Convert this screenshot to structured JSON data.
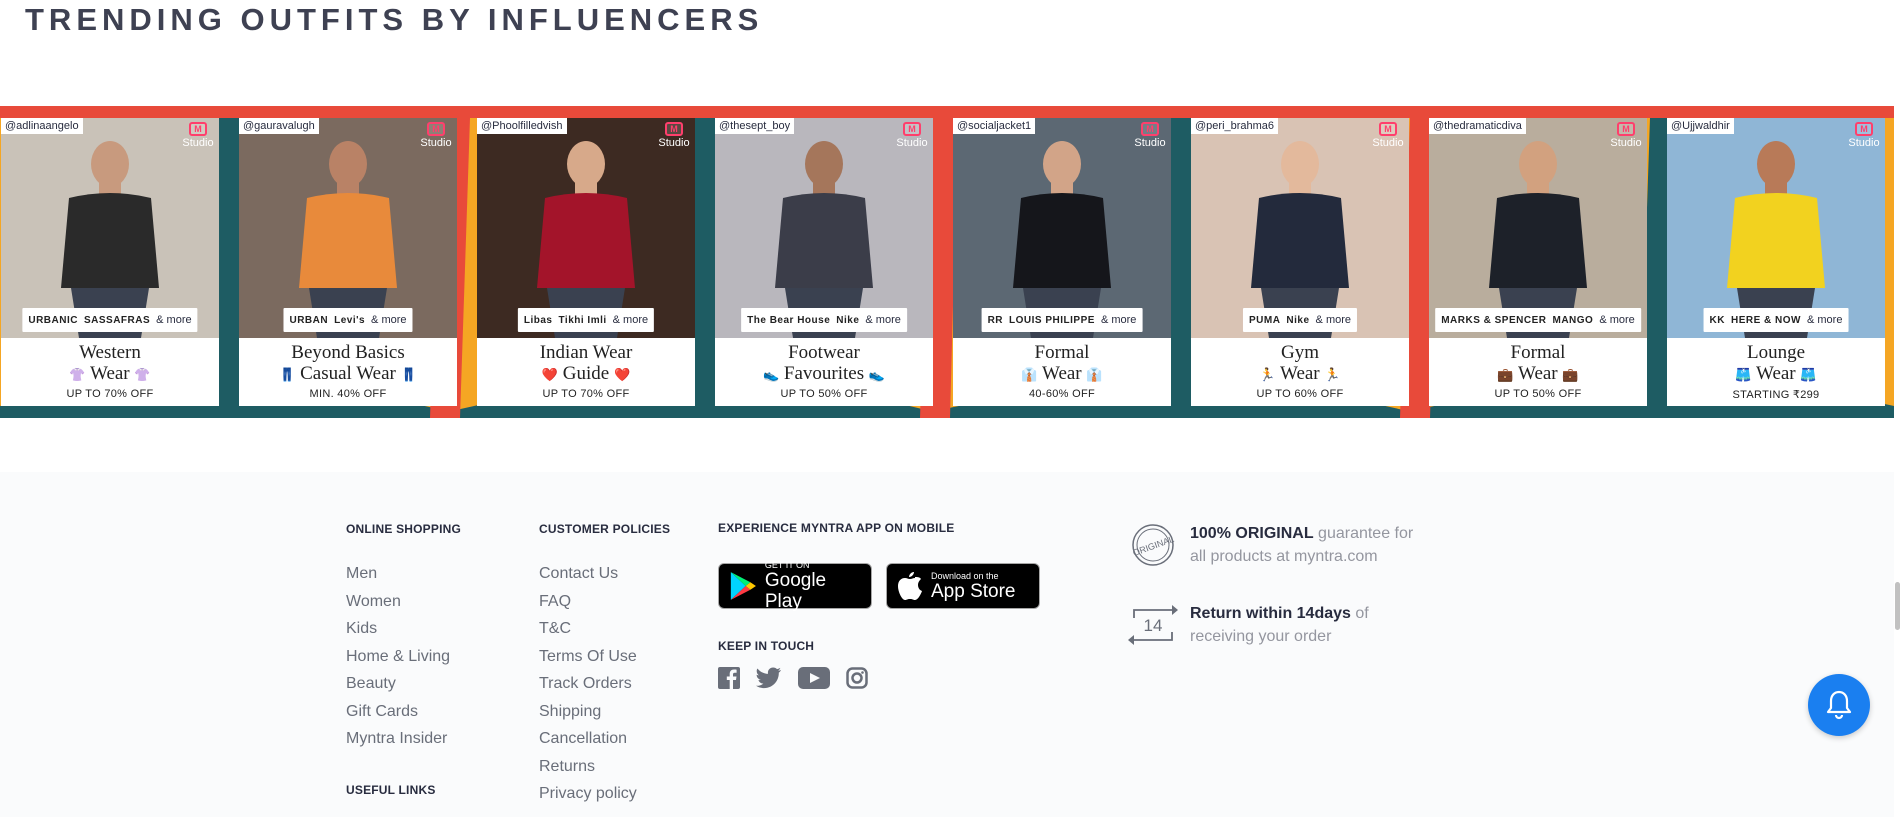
{
  "section_title": "TRENDING OUTFITS BY INFLUENCERS",
  "studio_label": "Studio",
  "cards": [
    {
      "handle": "@adlinaangelo",
      "brands": [
        "URBANIC",
        "SASSAFRAS"
      ],
      "more": "& more",
      "title_line1": "Western",
      "title_line2": "Wear",
      "emoji": "👚",
      "offer": "UP TO 70% OFF",
      "bg": "#c9c2b8",
      "skin": "#c89a7e",
      "cloth": "#2a2a2a"
    },
    {
      "handle": "@gauravalugh",
      "brands": [
        "URBAN",
        "Levi's"
      ],
      "more": "& more",
      "title_line1": "Beyond Basics",
      "title_line2": "Casual Wear",
      "emoji": "👖",
      "offer": "MIN. 40% OFF",
      "bg": "#7b6a5f",
      "skin": "#b98266",
      "cloth": "#e88a3b"
    },
    {
      "handle": "@Phoolfilledvish",
      "brands": [
        "Libas",
        "Tikhi Imli"
      ],
      "more": "& more",
      "title_line1": "Indian Wear",
      "title_line2": "Guide",
      "emoji": "❤️",
      "offer": "UP TO 70% OFF",
      "bg": "#3d2a22",
      "skin": "#d7a98a",
      "cloth": "#a3142a"
    },
    {
      "handle": "@thesept_boy",
      "brands": [
        "The Bear House",
        "Nike"
      ],
      "more": "& more",
      "title_line1": "Footwear",
      "title_line2": "Favourites",
      "emoji": "👟",
      "offer": "UP TO 50% OFF",
      "bg": "#b9b7bd",
      "skin": "#a5765b",
      "cloth": "#3b3d49"
    },
    {
      "handle": "@socialjacket1",
      "brands": [
        "RR",
        "LOUIS PHILIPPE"
      ],
      "more": "& more",
      "title_line1": "Formal",
      "title_line2": "Wear",
      "emoji": "👔",
      "offer": "40-60% OFF",
      "bg": "#5c6873",
      "skin": "#d2a488",
      "cloth": "#15161b"
    },
    {
      "handle": "@peri_brahma6",
      "brands": [
        "PUMA",
        "Nike"
      ],
      "more": "& more",
      "title_line1": "Gym",
      "title_line2": "Wear",
      "emoji": "🏃",
      "offer": "UP TO 60% OFF",
      "bg": "#d9c3b4",
      "skin": "#e3b99c",
      "cloth": "#232a3c"
    },
    {
      "handle": "@thedramaticdiva",
      "brands": [
        "MARKS & SPENCER",
        "MANGO"
      ],
      "more": "& more",
      "title_line1": "Formal",
      "title_line2": "Wear",
      "emoji": "💼",
      "offer": "UP TO 50% OFF",
      "bg": "#b9ad9d",
      "skin": "#d2a17f",
      "cloth": "#1d2129"
    },
    {
      "handle": "@Ujjwaldhir",
      "brands": [
        "KK",
        "HERE & NOW"
      ],
      "more": "& more",
      "title_line1": "Lounge",
      "title_line2": "Wear",
      "emoji": "🩳",
      "offer": "STARTING ₹299",
      "bg": "#8fb6d6",
      "skin": "#b87a58",
      "cloth": "#f2d21f"
    }
  ],
  "footer": {
    "online_shopping": {
      "heading": "ONLINE SHOPPING",
      "links": [
        "Men",
        "Women",
        "Kids",
        "Home & Living",
        "Beauty",
        "Gift Cards",
        "Myntra Insider"
      ]
    },
    "useful_links": {
      "heading": "USEFUL LINKS"
    },
    "customer_policies": {
      "heading": "CUSTOMER POLICIES",
      "links": [
        "Contact Us",
        "FAQ",
        "T&C",
        "Terms Of Use",
        "Track Orders",
        "Shipping",
        "Cancellation",
        "Returns",
        "Privacy policy"
      ]
    },
    "app": {
      "heading": "EXPERIENCE MYNTRA APP ON MOBILE",
      "google_small": "GET IT ON",
      "google_big": "Google Play",
      "apple_small": "Download on the",
      "apple_big": "App Store"
    },
    "keep_in_touch": {
      "heading": "KEEP IN TOUCH"
    },
    "promises": {
      "original_badge": "ORIGINAL",
      "original_bold": "100% ORIGINAL",
      "original_rest": " guarantee for all products at myntra.com",
      "return_days": "14",
      "return_bold": "Return within 14days",
      "return_rest": " of receiving your order"
    }
  },
  "colors": {
    "banner_orange": "#f05a3c",
    "banner_teal": "#1e5c63",
    "banner_yellow": "#f5a623",
    "footer_bg": "#fafbfc",
    "bell_blue": "#1a7ff0"
  }
}
